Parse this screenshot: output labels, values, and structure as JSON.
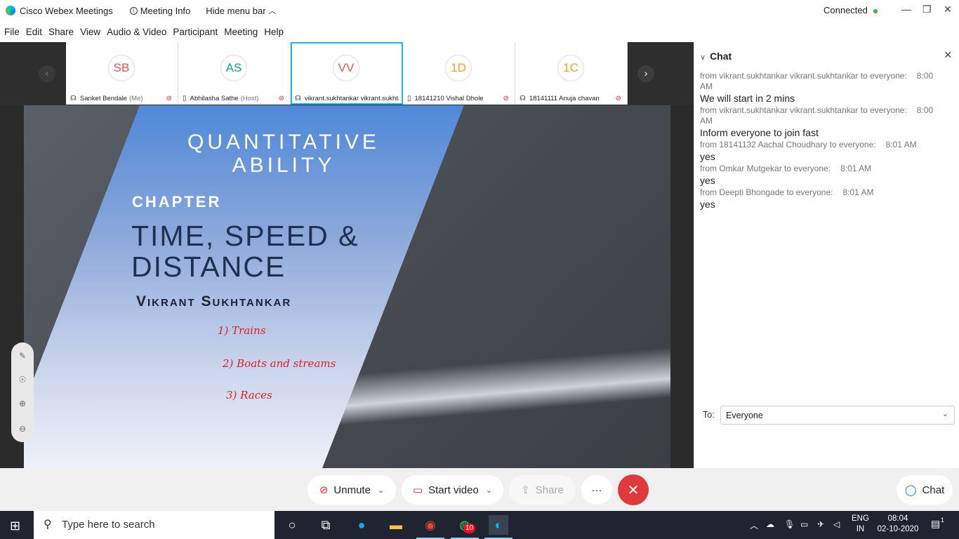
{
  "titlebar": {
    "app_name": "Cisco Webex Meetings",
    "meeting_info": "Meeting Info",
    "hide_menu": "Hide menu bar",
    "status": "Connected"
  },
  "menu": [
    "File",
    "Edit",
    "Share",
    "View",
    "Audio & Video",
    "Participant",
    "Meeting",
    "Help"
  ],
  "participants": [
    {
      "initials": "SB",
      "name": "Sanket Bendale",
      "tag": "(Me)",
      "color": "#e3574f"
    },
    {
      "initials": "AS",
      "name": "Abhilasha Sathe",
      "tag": "(Host)",
      "color": "#1aa37a"
    },
    {
      "initials": "VV",
      "name": "vikrant.sukhtankar vikrant.sukhta...",
      "tag": "",
      "color": "#e3574f"
    },
    {
      "initials": "1D",
      "name": "18141210 Vishal Dhole",
      "tag": "",
      "color": "#f0a030"
    },
    {
      "initials": "1C",
      "name": "18141111 Anuja chavan",
      "tag": "",
      "color": "#f0a030"
    }
  ],
  "slide": {
    "title": "QUANTITATIVE ABILITY",
    "chapter": "CHAPTER",
    "topic": "TIME, SPEED & DISTANCE",
    "author": "Vikrant Sukhtankar",
    "notes": [
      "1) Trains",
      "2) Boats and streams",
      "3) Races"
    ]
  },
  "chat": {
    "title": "Chat",
    "messages": [
      {
        "from": "from vikrant.sukhtankar vikrant.sukhtankar to everyone:",
        "time": "8:00 AM",
        "text": "We will start in 2 mins"
      },
      {
        "from": "from vikrant.sukhtankar vikrant.sukhtankar to everyone:",
        "time": "8:00 AM",
        "text": "Inform everyone to join fast"
      },
      {
        "from": "from 18141132 Aachal Choudhary to everyone:",
        "time": "8:01 AM",
        "text": "yes"
      },
      {
        "from": "from Omkar Mutgekar to everyone:",
        "time": "8:01 AM",
        "text": "yes"
      },
      {
        "from": "from Deepti Bhongade to everyone:",
        "time": "8:01 AM",
        "text": "yes"
      }
    ],
    "to_label": "To:",
    "to_value": "Everyone"
  },
  "controls": {
    "unmute": "Unmute",
    "start_video": "Start video",
    "share": "Share",
    "more": "···",
    "chat": "Chat"
  },
  "taskbar": {
    "search_placeholder": "Type here to search",
    "whatsapp_badge": "10",
    "lang_top": "ENG",
    "lang_bottom": "IN",
    "time": "08:04",
    "date": "02-10-2020",
    "notifications": "1"
  }
}
